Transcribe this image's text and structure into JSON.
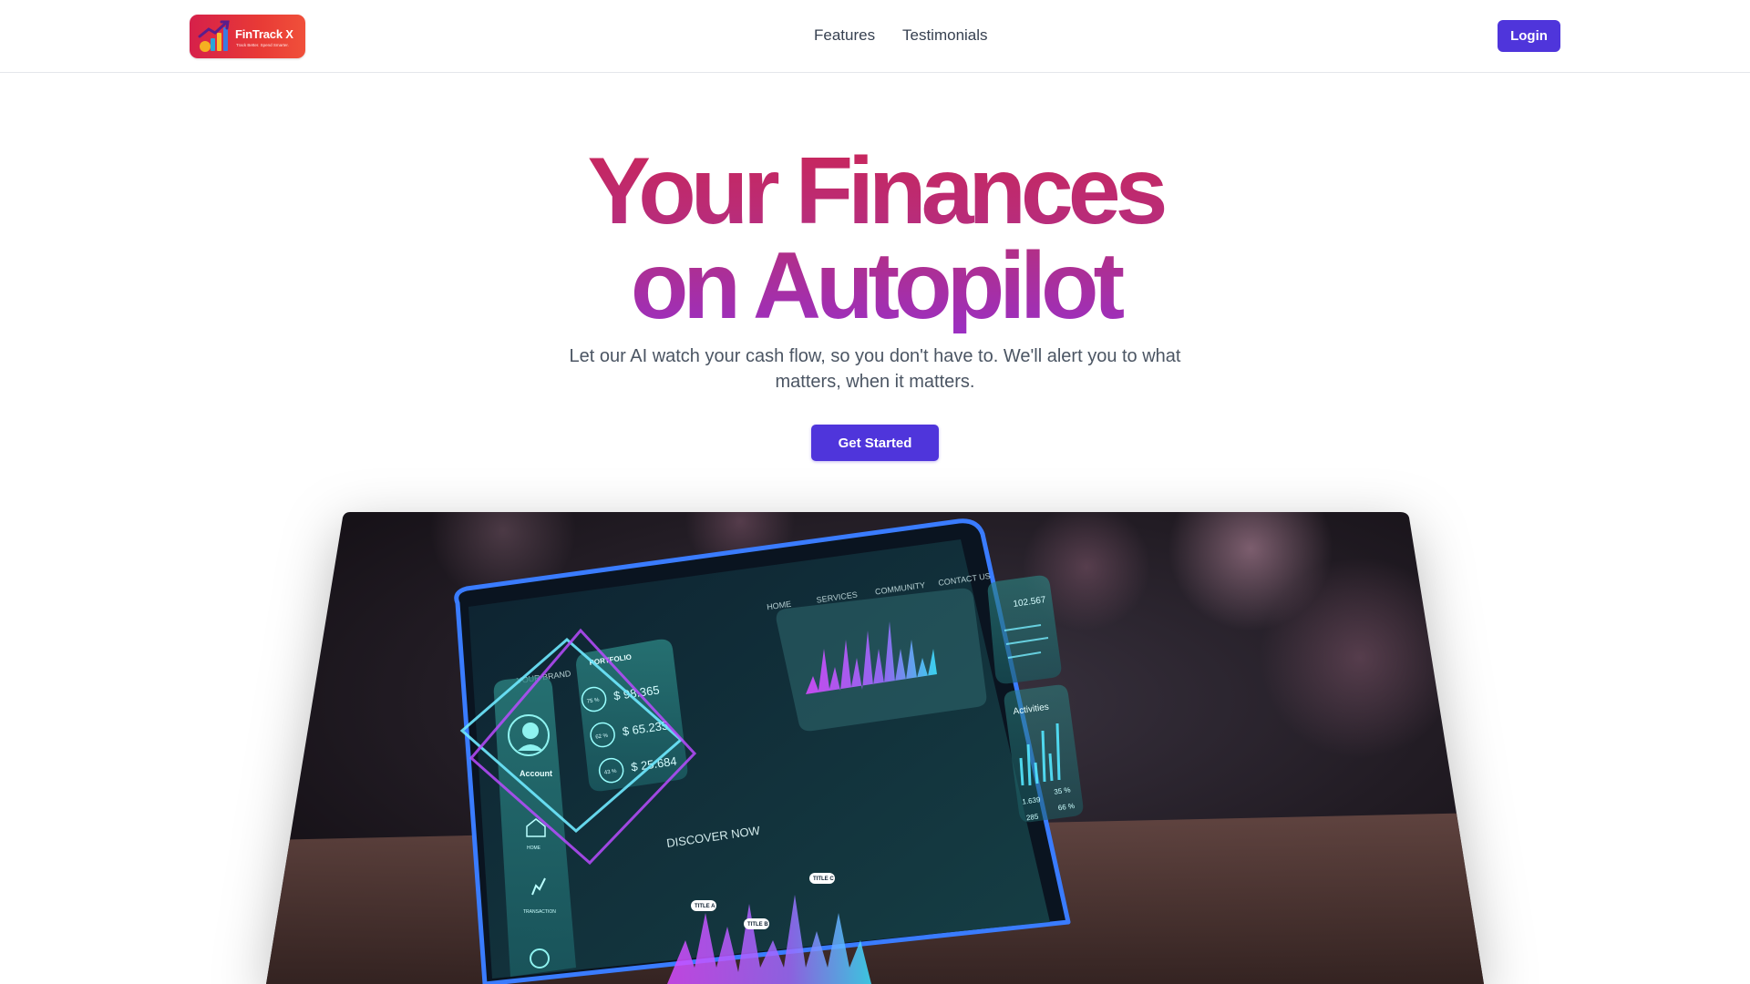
{
  "header": {
    "logo": {
      "wordmark": "FinTrack X",
      "tagline": "Track Better. Spend Smarter.",
      "icon": "bar-chart-arrow-icon",
      "color_start": "#d6204a",
      "color_end": "#f0503a"
    },
    "nav": [
      {
        "label": "Features"
      },
      {
        "label": "Testimonials"
      }
    ],
    "login_label": "Login"
  },
  "hero": {
    "title_line_1": "Your Finances",
    "title_line_2": "on Autopilot",
    "subtitle": "Let our AI watch your cash flow, so you don't have to. We'll alert you to what matters, when it matters.",
    "cta_label": "Get Started",
    "title_gradient": [
      "#c9265a",
      "#9b2fc2"
    ],
    "accent": "#4f35db"
  },
  "hero_image": {
    "brand": "YOUR BRAND",
    "nav_items": [
      "HOME",
      "SERVICES",
      "COMMUNITY",
      "CONTACT US"
    ],
    "portfolio_title": "PORTFOLIO",
    "portfolio_rows": [
      {
        "percent": "75 %",
        "amount": "$ 98.365"
      },
      {
        "percent": "62 %",
        "amount": "$ 65.235"
      },
      {
        "percent": "43 %",
        "amount": "$ 25.684"
      }
    ],
    "account_label": "Account",
    "home_label": "HOME",
    "transaction_label": "TRANSACTION",
    "discover_label": "DISCOVER NOW",
    "activities_label": "Activities",
    "stat_value": "102.567",
    "chart_labels": [
      "TITLE A",
      "TITLE B",
      "TITLE C"
    ],
    "activity_values": [
      "1.639",
      "35 %",
      "285",
      "66 %"
    ]
  }
}
